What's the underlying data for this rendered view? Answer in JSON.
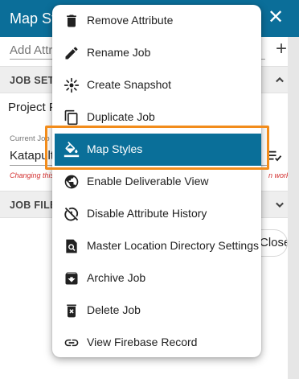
{
  "panel": {
    "title": "Map Styles",
    "add_attribute_placeholder": "Add Attribute",
    "sections": {
      "job_settings": "JOB SETTINGS",
      "job_files": "JOB FILES"
    },
    "project_label": "Project Folder",
    "current_job": {
      "label": "Current Job",
      "value": "Katapult"
    },
    "warning": {
      "left": "Changing this",
      "right": "n work!"
    },
    "close_button": "Close"
  },
  "menu": {
    "items": [
      {
        "label": "Remove Attribute",
        "icon": "trash-icon"
      },
      {
        "label": "Rename Job",
        "icon": "pencil-icon"
      },
      {
        "label": "Create Snapshot",
        "icon": "snapshot-icon"
      },
      {
        "label": "Duplicate Job",
        "icon": "copy-icon"
      },
      {
        "label": "Map Styles",
        "icon": "paint-bucket-icon",
        "selected": true
      },
      {
        "label": "Enable Deliverable View",
        "icon": "globe-icon"
      },
      {
        "label": "Disable Attribute History",
        "icon": "history-off-icon"
      },
      {
        "label": "Master Location Directory Settings",
        "icon": "find-in-page-icon"
      },
      {
        "label": "Archive Job",
        "icon": "archive-icon"
      },
      {
        "label": "Delete Job",
        "icon": "delete-box-icon"
      },
      {
        "label": "View Firebase Record",
        "icon": "link-icon"
      }
    ]
  },
  "colors": {
    "header": "#0b6e99",
    "selected_item": "#0a6f99",
    "highlight_outline": "#f28c1b",
    "warning_text": "#d32f2f"
  }
}
